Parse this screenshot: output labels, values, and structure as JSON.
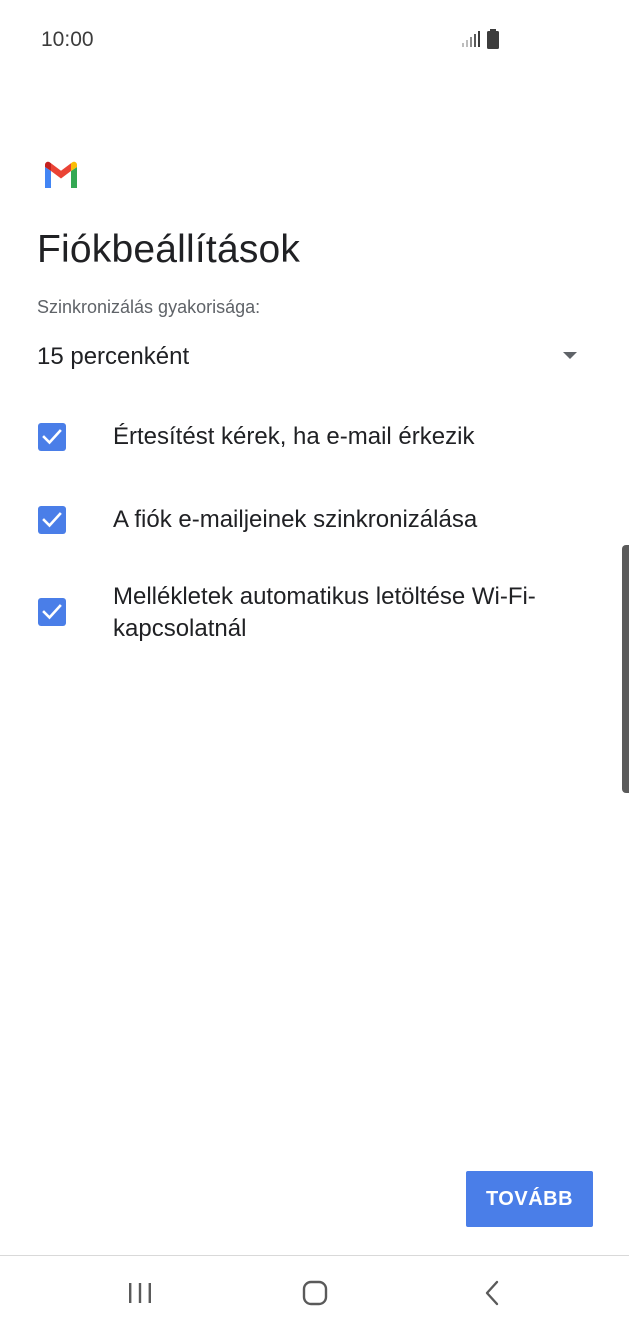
{
  "status_bar": {
    "time": "10:00"
  },
  "header": {
    "logo_icon": "gmail-logo-icon",
    "title": "Fiókbeállítások"
  },
  "sync": {
    "label": "Szinkronizálás gyakorisága:",
    "value": "15 percenként"
  },
  "options": [
    {
      "label": "Értesítést kérek, ha e-mail érkezik",
      "checked": true
    },
    {
      "label": "A fiók e-mailjeinek szinkronizálása",
      "checked": true
    },
    {
      "label": "Mellékletek automatikus letöltése Wi-Fi-kapcsolatnál",
      "checked": true
    }
  ],
  "actions": {
    "next_label": "TOVÁBB"
  },
  "colors": {
    "accent": "#4a7ee8",
    "text_primary": "#202124",
    "text_secondary": "#5f6368"
  }
}
